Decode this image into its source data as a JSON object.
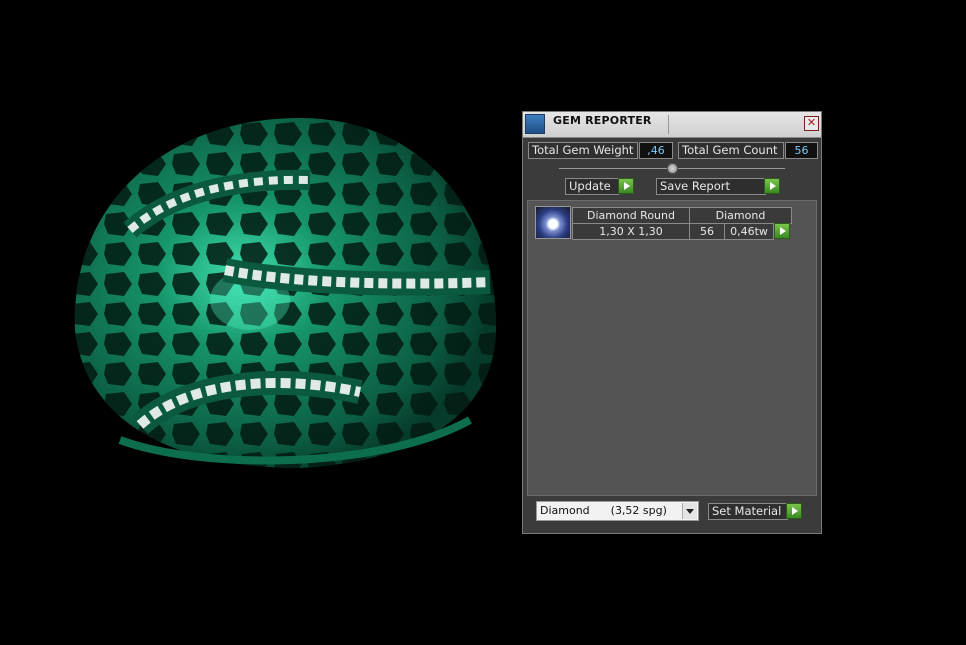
{
  "panel": {
    "title": "GEM REPORTER",
    "close_glyph": "✕",
    "total_weight_label": "Total Gem Weight",
    "total_weight_value": ",46",
    "total_count_label": "Total Gem Count",
    "total_count_value": "56",
    "update_label": "Update",
    "save_report_label": "Save Report",
    "gem_list": [
      {
        "shape": "Diamond Round",
        "material": "Diamond",
        "size": "1,30 X 1,30",
        "count": "56",
        "weight": "0,46tw"
      }
    ],
    "material_select": "Diamond      (3,52 spg)",
    "set_material_label": "Set Material"
  },
  "colors": {
    "accent_green": "#3a8a22",
    "value_blue": "#7ec8ff",
    "ring_green": "#178a63"
  },
  "icons": {
    "title": "gem-reporter-app-icon",
    "close": "close-icon",
    "go": "play-arrow-icon",
    "thumb": "diamond-gem-thumbnail",
    "knob": "splitter-knob-icon",
    "dropdown": "chevron-down-icon"
  }
}
